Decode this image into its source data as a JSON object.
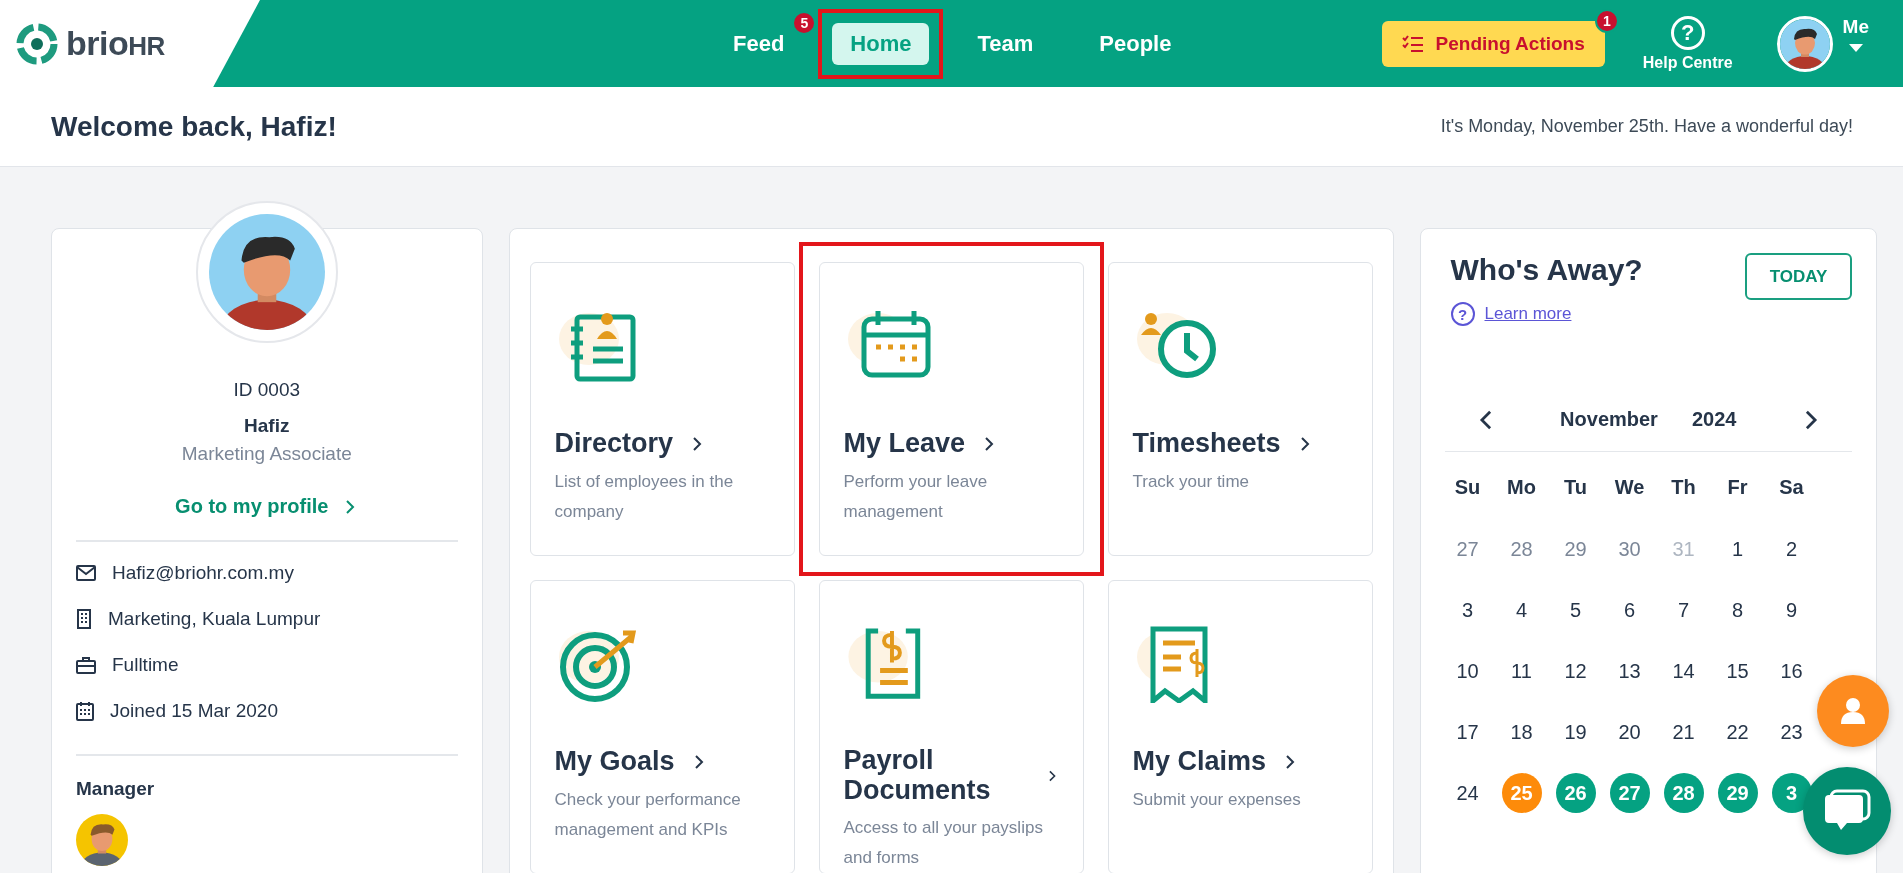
{
  "header": {
    "logo": {
      "brand": "brio",
      "suffix": "HR"
    },
    "nav": [
      {
        "label": "Feed",
        "selected": false,
        "badge": "5",
        "highlighted": false
      },
      {
        "label": "Home",
        "selected": true,
        "highlighted": true
      },
      {
        "label": "Team",
        "selected": false,
        "highlighted": false
      },
      {
        "label": "People",
        "selected": false,
        "highlighted": false
      }
    ],
    "pending": {
      "label": "Pending Actions",
      "badge": "1"
    },
    "help": {
      "label": "Help Centre",
      "glyph": "?"
    },
    "user": {
      "label": "Me"
    }
  },
  "welcome": {
    "title": "Welcome back, Hafiz!",
    "date_line": "It's Monday, November 25th. Have a wonderful day!"
  },
  "profile": {
    "id": "ID 0003",
    "name": "Hafiz",
    "role": "Marketing Associate",
    "link": "Go to my profile",
    "details": [
      {
        "kind": "email",
        "text": "Hafiz@briohr.com.my"
      },
      {
        "kind": "office",
        "text": "Marketing, Kuala Lumpur"
      },
      {
        "kind": "type",
        "text": "Fulltime"
      },
      {
        "kind": "joined",
        "text": "Joined 15 Mar 2020"
      }
    ],
    "manager_label": "Manager"
  },
  "tiles": [
    {
      "kind": "directory",
      "title": "Directory",
      "description": "List of employees in the company",
      "highlighted": false
    },
    {
      "kind": "leave",
      "title": "My Leave",
      "description": "Perform your leave management",
      "highlighted": true
    },
    {
      "kind": "timesheets",
      "title": "Timesheets",
      "description": "Track your time",
      "highlighted": false
    },
    {
      "kind": "goals",
      "title": "My Goals",
      "description": "Check your performance management and KPIs",
      "highlighted": false
    },
    {
      "kind": "payroll",
      "title": "Payroll Documents",
      "description": "Access to all your payslips and forms",
      "highlighted": false
    },
    {
      "kind": "claims",
      "title": "My Claims",
      "description": "Submit your expenses",
      "highlighted": false
    }
  ],
  "whos_away": {
    "title": "Who's Away?",
    "today_button": "TODAY",
    "learn_more": "Learn more",
    "help_glyph": "?",
    "month": "November",
    "year": "2024",
    "weekdays": [
      "Su",
      "Mo",
      "Tu",
      "We",
      "Th",
      "Fr",
      "Sa"
    ],
    "days": [
      {
        "label": "27",
        "kind": "other"
      },
      {
        "label": "28",
        "kind": "other"
      },
      {
        "label": "29",
        "kind": "other"
      },
      {
        "label": "30",
        "kind": "other"
      },
      {
        "label": "31",
        "kind": "faded"
      },
      {
        "label": "1",
        "kind": "normal"
      },
      {
        "label": "2",
        "kind": "normal"
      },
      {
        "label": "3",
        "kind": "normal"
      },
      {
        "label": "4",
        "kind": "normal"
      },
      {
        "label": "5",
        "kind": "normal"
      },
      {
        "label": "6",
        "kind": "normal"
      },
      {
        "label": "7",
        "kind": "normal"
      },
      {
        "label": "8",
        "kind": "normal"
      },
      {
        "label": "9",
        "kind": "normal"
      },
      {
        "label": "10",
        "kind": "normal"
      },
      {
        "label": "11",
        "kind": "normal"
      },
      {
        "label": "12",
        "kind": "normal"
      },
      {
        "label": "13",
        "kind": "normal"
      },
      {
        "label": "14",
        "kind": "normal"
      },
      {
        "label": "15",
        "kind": "normal"
      },
      {
        "label": "16",
        "kind": "normal"
      },
      {
        "label": "17",
        "kind": "normal"
      },
      {
        "label": "18",
        "kind": "normal"
      },
      {
        "label": "19",
        "kind": "normal"
      },
      {
        "label": "20",
        "kind": "normal"
      },
      {
        "label": "21",
        "kind": "normal"
      },
      {
        "label": "22",
        "kind": "normal"
      },
      {
        "label": "23",
        "kind": "normal"
      },
      {
        "label": "24",
        "kind": "normal"
      },
      {
        "label": "25",
        "kind": "today"
      },
      {
        "label": "26",
        "kind": "away"
      },
      {
        "label": "27",
        "kind": "away"
      },
      {
        "label": "28",
        "kind": "away"
      },
      {
        "label": "29",
        "kind": "away"
      },
      {
        "label": "3",
        "kind": "away"
      }
    ]
  }
}
